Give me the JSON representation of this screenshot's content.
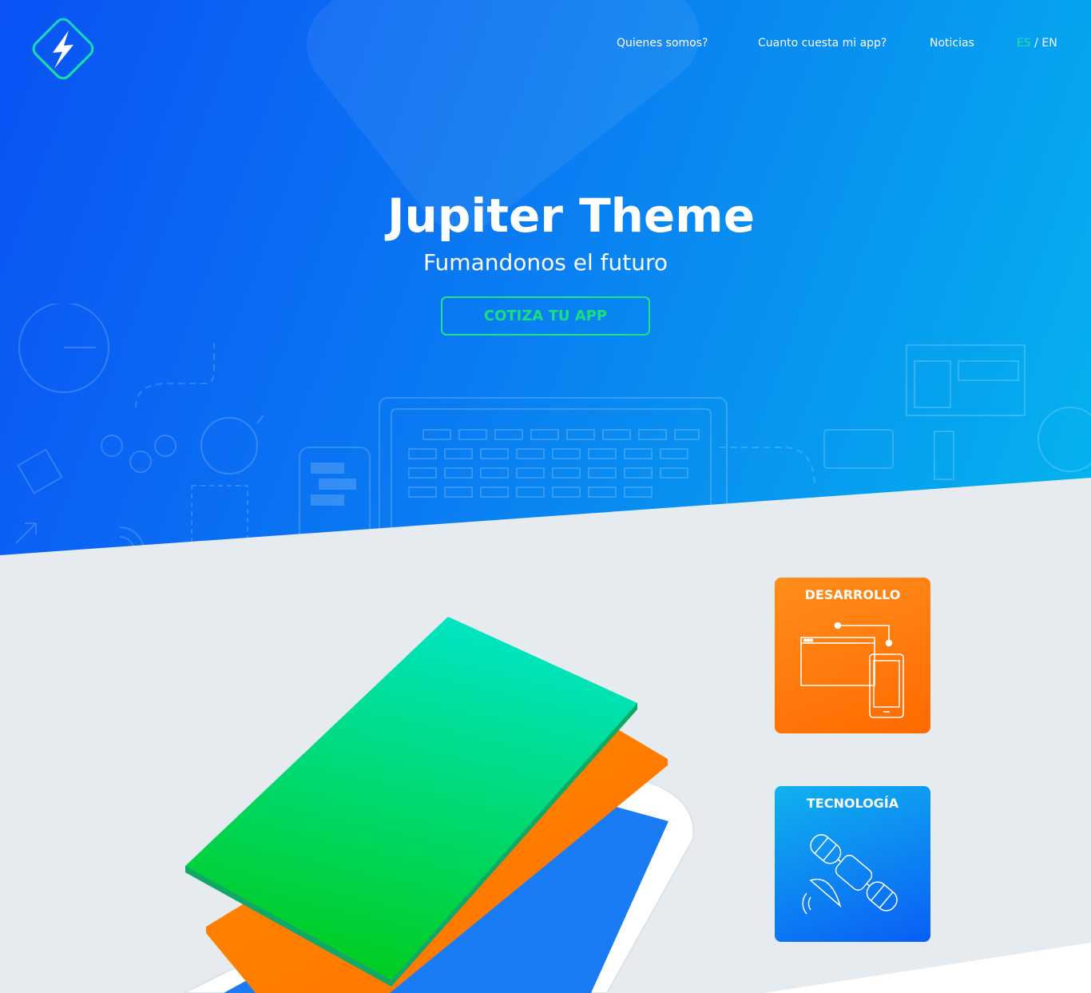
{
  "nav": {
    "items": [
      {
        "label": "Quienes somos?"
      },
      {
        "label": "Cuanto cuesta mi app?"
      },
      {
        "label": "Noticias"
      }
    ],
    "lang_es": "ES",
    "lang_sep": " / ",
    "lang_en": "EN"
  },
  "hero": {
    "title": "Jupiter Theme",
    "subtitle": "Fumandonos el futuro",
    "cta_label": "COTIZA TU APP"
  },
  "cards": {
    "development": "DESARROLLO",
    "technology": "TECNOLOGÍA"
  },
  "colors": {
    "hero_start": "#0a52f5",
    "hero_end": "#05b4ee",
    "accent_green": "#1fe38a",
    "orange": "#ff7a00",
    "section_bg": "#e6ebf0"
  },
  "icons": {
    "logo": "lightning-bolt-logo",
    "dev": "browser-and-phone-icon",
    "tech": "satellite-icon"
  }
}
